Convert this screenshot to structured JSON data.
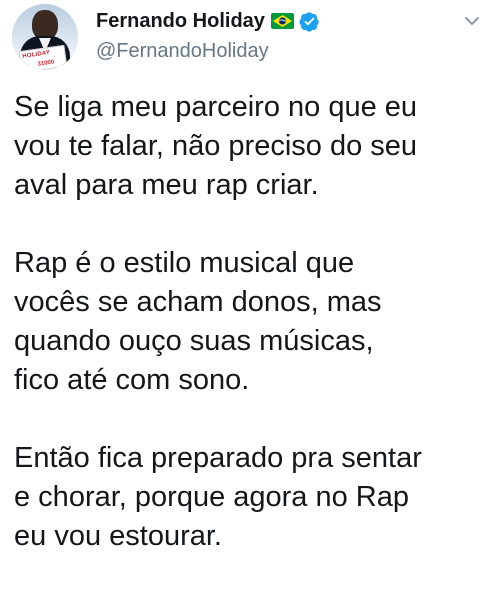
{
  "user": {
    "display_name": "Fernando Holiday",
    "handle": "@FernandoHoliday",
    "flag_icon": "brazil-flag-icon",
    "verified_icon": "verified-badge-icon",
    "avatar_sign_text": "HOLIDAY",
    "avatar_sign_number": "31000"
  },
  "tweet": {
    "paragraphs": [
      {
        "lines": [
          "Se liga meu parceiro no que eu",
          "vou te falar, não preciso do seu",
          "aval para meu rap criar."
        ]
      },
      {
        "lines": [
          "Rap é o estilo musical que",
          "vocês se acham donos, mas",
          "quando ouço suas músicas,",
          "fico até com sono."
        ]
      },
      {
        "lines": [
          "Então fica preparado pra sentar",
          "e chorar, porque agora no Rap",
          "eu vou estourar."
        ]
      }
    ]
  },
  "colors": {
    "text": "#14171a",
    "secondary_text": "#657786",
    "verified_blue": "#1da1f2",
    "flag_green": "#009b3a",
    "flag_yellow": "#fedf00",
    "flag_blue": "#002776"
  },
  "menu": {
    "icon": "chevron-down-icon"
  }
}
